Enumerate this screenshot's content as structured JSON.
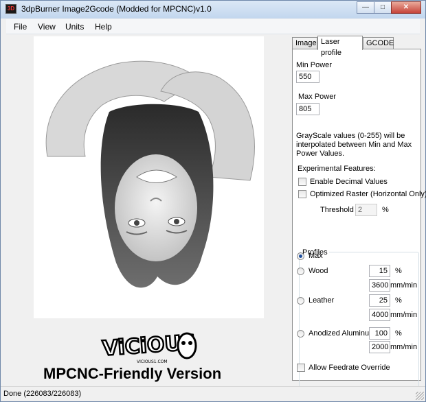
{
  "window": {
    "title": "3dpBurner Image2Gcode (Modded for MPCNC)v1.0",
    "icon_text": "3D",
    "controls": {
      "minimize": "—",
      "maximize": "□",
      "close": "✕"
    }
  },
  "menu": [
    "File",
    "View",
    "Units",
    "Help"
  ],
  "tabs": [
    "Image",
    "Laser profile",
    "GCODE"
  ],
  "active_tab": "Laser profile",
  "laser": {
    "min_power_label": "Min Power",
    "min_power": "550",
    "max_power_label": "Max Power",
    "max_power": "805",
    "grayscale_note": "GrayScale values (0-255) will be interpolated between Min and Max Power Values.",
    "experimental_label": "Experimental Features:",
    "decimal_label": "Enable Decimal Values",
    "raster_label": "Optimized Raster (Horizontal Only)",
    "threshold_label": "Threshold",
    "threshold_value": "2",
    "threshold_unit": "%"
  },
  "profiles": {
    "title": "Profiles",
    "selected": "Max",
    "items": [
      {
        "name": "Max"
      },
      {
        "name": "Wood",
        "power": "15",
        "feed": "3600"
      },
      {
        "name": "Leather",
        "power": "25",
        "feed": "4000"
      },
      {
        "name": "Anodized Aluminum",
        "power": "100",
        "feed": "2000"
      }
    ],
    "power_unit": "%",
    "feed_unit": "mm/min",
    "override_label": "Allow Feedrate Override"
  },
  "logo": {
    "graffiti_text": "ViCiOUS",
    "small_text": "VICIOUS1.COM",
    "caption": "MPCNC-Friendly Version"
  },
  "status": "Done (226083/226083)"
}
